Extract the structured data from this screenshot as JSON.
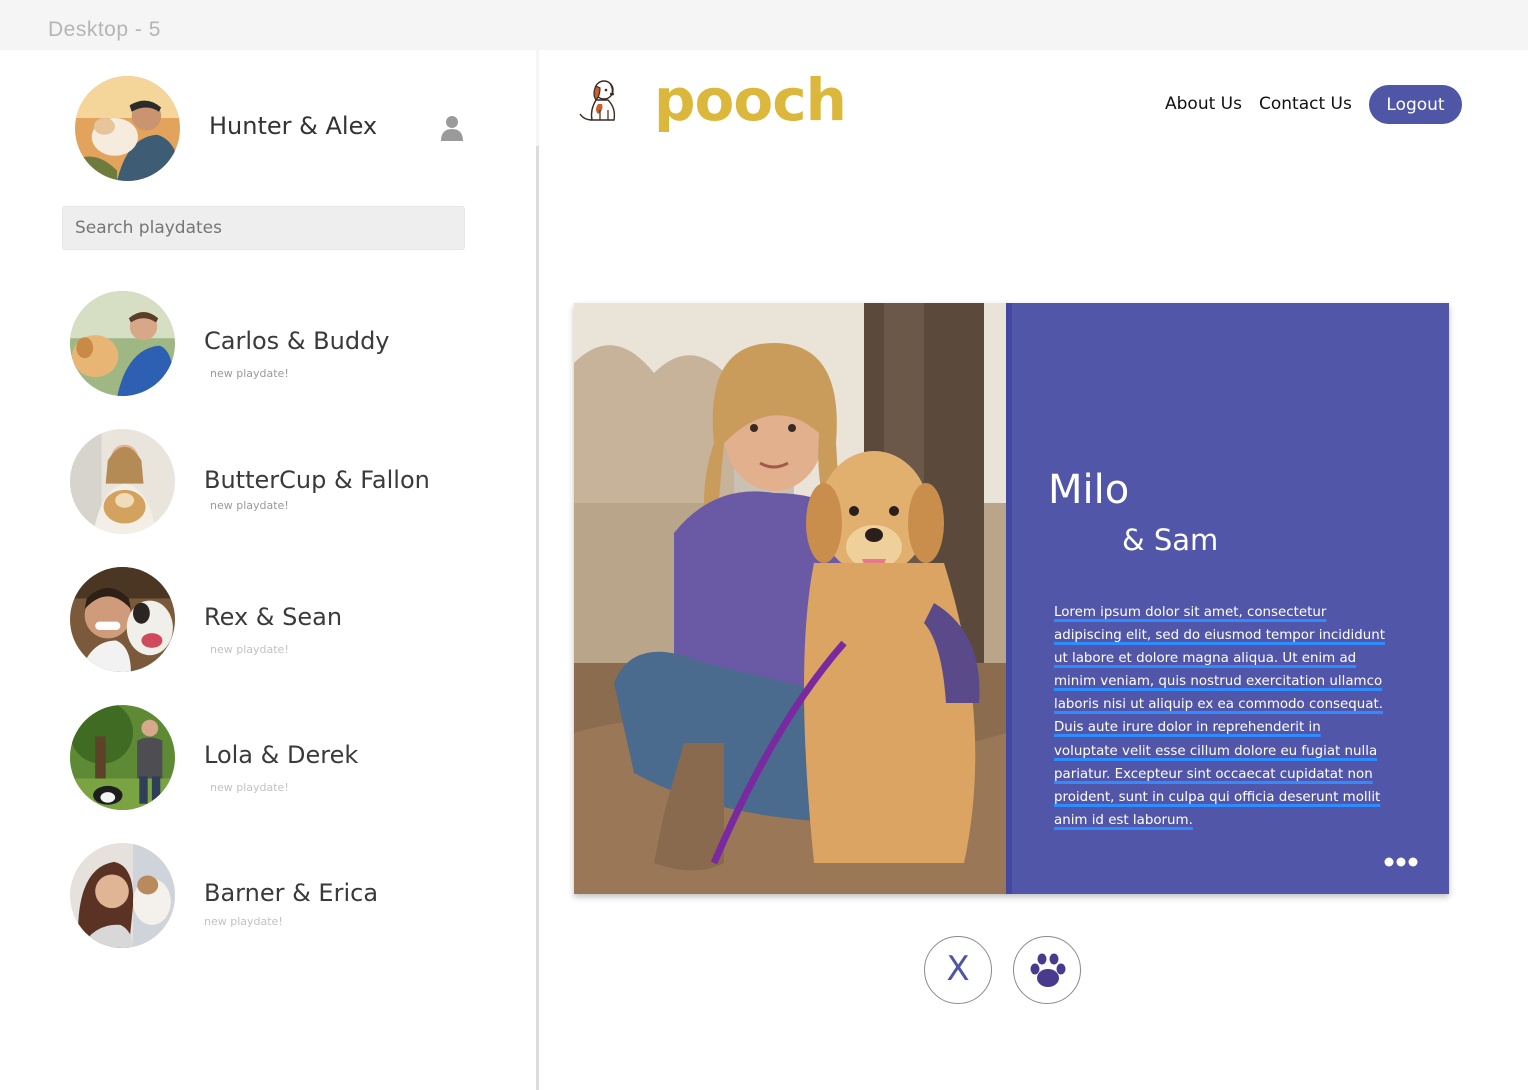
{
  "frame_label": "Desktop - 5",
  "user": {
    "name": "Hunter & Alex",
    "icon": "user-icon"
  },
  "search": {
    "placeholder": "Search playdates"
  },
  "matches": [
    {
      "name": "Carlos & Buddy",
      "sub": "new playdate!"
    },
    {
      "name": "ButterCup & Fallon",
      "sub": "new playdate!"
    },
    {
      "name": "Rex & Sean",
      "sub": "new playdate!"
    },
    {
      "name": "Lola & Derek",
      "sub": "new playdate!"
    },
    {
      "name": "Barner & Erica",
      "sub": "new playdate!"
    }
  ],
  "header": {
    "brand": "pooch",
    "nav": {
      "about": "About Us",
      "contact": "Contact Us"
    },
    "logout": "Logout"
  },
  "profile": {
    "dog_name": "Milo",
    "owner_name": "& Sam",
    "bio": "Lorem ipsum dolor sit amet, consectetur adipiscing elit, sed do eiusmod tempor incididunt ut labore et dolore magna aliqua. Ut enim ad minim veniam, quis nostrud exercitation ullamco laboris nisi ut aliquip ex ea commodo consequat. Duis aute irure dolor in reprehenderit in voluptate velit esse cillum dolore eu fugiat nulla pariatur. Excepteur sint occaecat cupidatat non proident, sunt in culpa qui officia deserunt mollit anim id est laborum."
  },
  "actions": {
    "reject": "X",
    "like_icon": "paw-icon"
  },
  "colors": {
    "brand": "#dbb83c",
    "accent": "#5056a6",
    "panel": "#5156a8"
  }
}
